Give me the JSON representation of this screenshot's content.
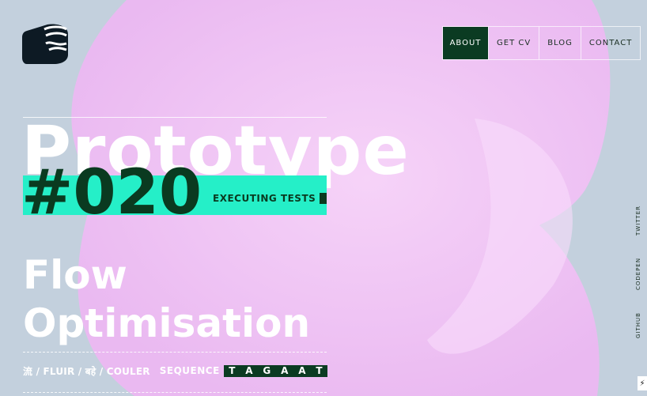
{
  "nav": {
    "items": [
      "ABOUT",
      "GET CV",
      "BLOG",
      "CONTACT"
    ]
  },
  "hero": {
    "word": "Prototype",
    "number": "#020",
    "status": "EXECUTING TESTS",
    "title_line1": "Flow",
    "title_line2": "Optimisation"
  },
  "footer_line": {
    "translations": "流 / FLUIR / बहे / COULER",
    "sequence_label": "SEQUENCE",
    "sequence_letters": [
      "T",
      "A",
      "G",
      "A",
      "A",
      "T"
    ]
  },
  "social": {
    "twitter": "TWITTER",
    "codepen": "CODEPEN",
    "github": "GITHUB"
  },
  "colors": {
    "background": "#c3d0dd",
    "blob": "#f2c6f5",
    "accent_band": "#25efc8",
    "dark_green": "#0b3b22"
  },
  "icons": {
    "logo": "logo-icon",
    "corner": "lightning-icon"
  }
}
